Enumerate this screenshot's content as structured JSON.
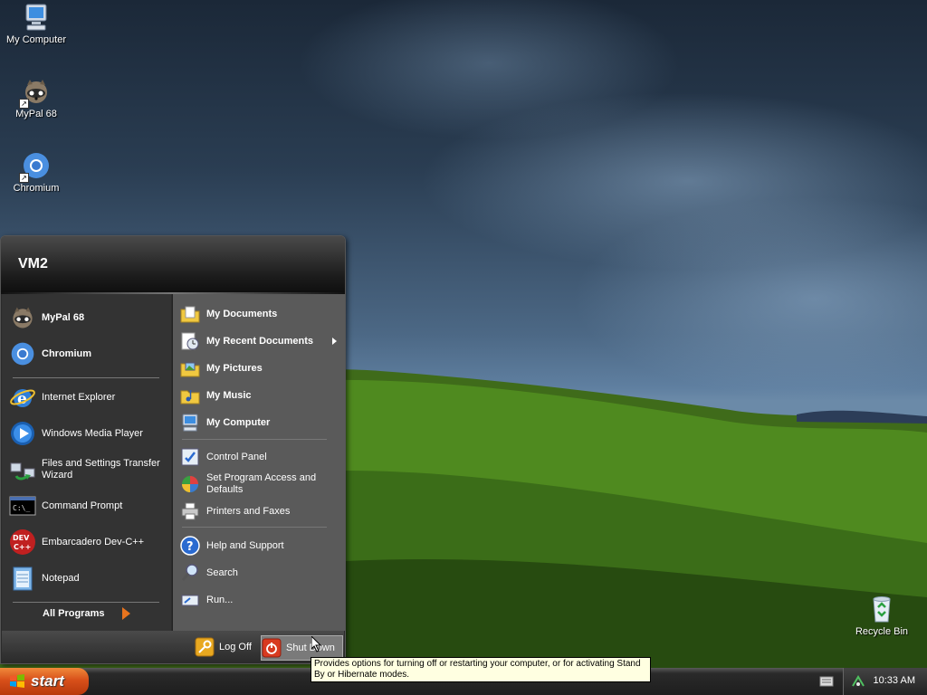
{
  "desktop": {
    "icons": [
      {
        "label": "My Computer",
        "icon": "my-computer-icon"
      },
      {
        "label": "MyPal 68",
        "icon": "mypal-icon"
      },
      {
        "label": "Chromium",
        "icon": "chromium-icon"
      },
      {
        "label": "Recycle Bin",
        "icon": "recycle-bin-icon"
      }
    ]
  },
  "start_menu": {
    "user_name": "VM2",
    "pinned": [
      {
        "label": "MyPal 68",
        "icon": "mypal-icon"
      },
      {
        "label": "Chromium",
        "icon": "chromium-icon"
      }
    ],
    "recent": [
      {
        "label": "Internet Explorer",
        "icon": "internet-explorer-icon"
      },
      {
        "label": "Windows Media Player",
        "icon": "media-player-icon"
      },
      {
        "label": "Files and Settings Transfer Wizard",
        "icon": "transfer-wizard-icon"
      },
      {
        "label": "Command Prompt",
        "icon": "command-prompt-icon"
      },
      {
        "label": "Embarcadero Dev-C++",
        "icon": "devcpp-icon"
      },
      {
        "label": "Notepad",
        "icon": "notepad-icon"
      }
    ],
    "all_programs": "All Programs",
    "places": [
      {
        "label": "My Documents",
        "icon": "folder-documents-icon"
      },
      {
        "label": "My Recent Documents",
        "icon": "recent-documents-icon"
      },
      {
        "label": "My Pictures",
        "icon": "folder-pictures-icon"
      },
      {
        "label": "My Music",
        "icon": "folder-music-icon"
      },
      {
        "label": "My Computer",
        "icon": "my-computer-icon"
      }
    ],
    "settings": [
      {
        "label": "Control Panel",
        "icon": "control-panel-icon"
      },
      {
        "label": "Set Program Access and Defaults",
        "icon": "program-access-icon"
      },
      {
        "label": "Printers and Faxes",
        "icon": "printer-icon"
      }
    ],
    "help": [
      {
        "label": "Help and Support",
        "icon": "help-icon"
      },
      {
        "label": "Search",
        "icon": "search-icon"
      },
      {
        "label": "Run...",
        "icon": "run-icon"
      }
    ],
    "log_off": "Log Off",
    "shut_down": "Shut Down"
  },
  "tooltip": {
    "text": "Provides options for turning off or restarting your computer, or for activating Stand By or Hibernate modes."
  },
  "taskbar": {
    "start_label": "start",
    "clock": "10:33 AM"
  }
}
